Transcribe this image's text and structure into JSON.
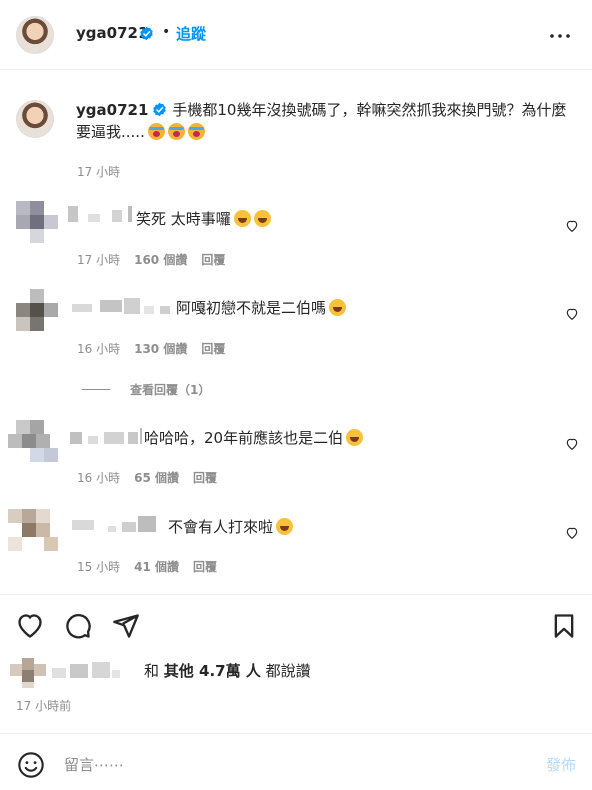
{
  "header": {
    "username": "yga0721",
    "separator": "•",
    "follow_label": "追蹤"
  },
  "caption": {
    "username": "yga0721",
    "text": "手機都10幾年沒換號碼了，幹嘛突然抓我來換門號？為什麼要逼我.....",
    "emojis": [
      "crying-face",
      "crying-face",
      "crying-face"
    ],
    "time": "17 小時"
  },
  "comments": [
    {
      "text": "笑死 太時事囉",
      "emojis": [
        "laughing-face",
        "laughing-face"
      ],
      "time": "17 小時",
      "likes": "160 個讚",
      "reply": "回覆"
    },
    {
      "text": "阿嘎初戀不就是二伯嗎",
      "emojis": [
        "laughing-face"
      ],
      "time": "16 小時",
      "likes": "130 個讚",
      "reply": "回覆",
      "view_replies": "查看回覆（1）"
    },
    {
      "text": "哈哈哈，20年前應該也是二伯",
      "emojis": [
        "laughing-face"
      ],
      "time": "16 小時",
      "likes": "65 個讚",
      "reply": "回覆"
    },
    {
      "text": "不會有人打來啦",
      "emojis": [
        "laughing-face"
      ],
      "time": "15 小時",
      "likes": "41 個讚",
      "reply": "回覆"
    }
  ],
  "likes_summary": {
    "and": "和",
    "others": "其他 4.7萬 人",
    "suffix": "都說讚"
  },
  "time_ago": "17 小時前",
  "comment_bar": {
    "placeholder": "留言⋯⋯",
    "post_label": "發佈"
  },
  "colors": {
    "link_blue": "#0095f6",
    "post_disabled": "#b3dbff",
    "meta_gray": "#8e8e8e"
  }
}
